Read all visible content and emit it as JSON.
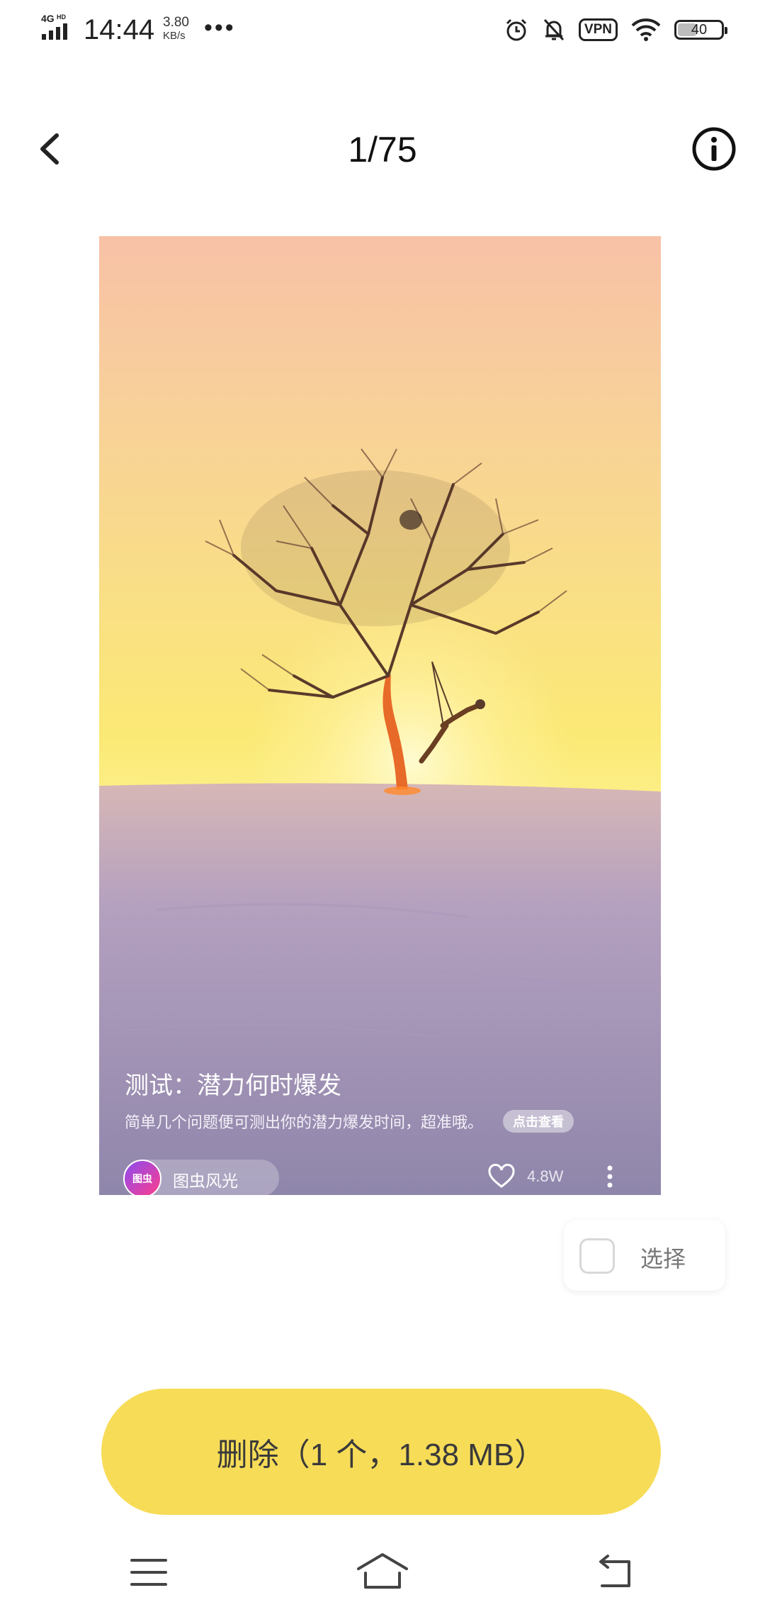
{
  "status_bar": {
    "network": "4G HD",
    "time": "14:44",
    "speed_value": "3.80",
    "speed_unit": "KB/s",
    "more": "•••",
    "vpn": "VPN",
    "battery": "40",
    "icons": [
      "alarm-icon",
      "mute-bell-icon",
      "vpn-icon",
      "wifi-icon",
      "battery-icon"
    ]
  },
  "header": {
    "counter": "1/75",
    "back_icon": "chevron-left-icon",
    "info_icon": "info-circle-icon"
  },
  "card": {
    "title": "测试：潜力何时爆发",
    "description": "简单几个问题便可测出你的潜力爆发时间，超准哦。",
    "view_button": "点击查看",
    "author": "图虫风光",
    "avatar_text": "图虫",
    "likes": "4.8W",
    "colors": {
      "sky_top": "#f7c1a6",
      "sun": "#fcf08a",
      "snow": "#938aae"
    }
  },
  "select": {
    "label": "选择",
    "checked": false
  },
  "delete_button": {
    "label": "删除（1 个，1.38 MB）",
    "color": "#f7dc58"
  },
  "nav_bar": {
    "icons": [
      "menu-icon",
      "home-icon",
      "back-icon"
    ]
  }
}
